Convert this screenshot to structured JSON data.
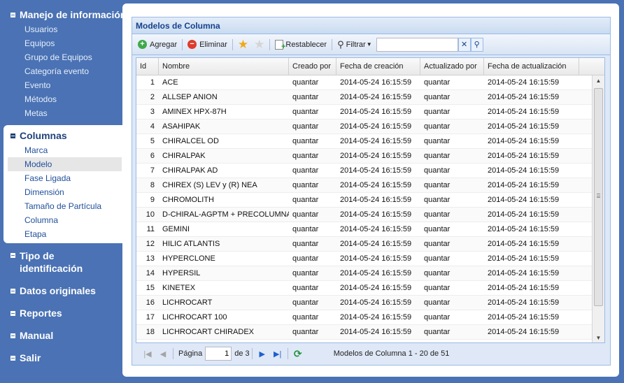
{
  "sidebar": {
    "groups": [
      {
        "label": "Manejo de información",
        "items": [
          "Usuarios",
          "Equipos",
          "Grupo de Equipos",
          "Categoría evento",
          "Evento",
          "Métodos",
          "Metas"
        ]
      },
      {
        "label": "Columnas",
        "items": [
          "Marca",
          "Modelo",
          "Fase Ligada",
          "Dimensión",
          "Tamaño de Partícula",
          "Columna",
          "Etapa"
        ]
      },
      {
        "label": "Tipo de identificación"
      },
      {
        "label": "Datos originales"
      },
      {
        "label": "Reportes"
      },
      {
        "label": "Manual"
      },
      {
        "label": "Salir"
      }
    ]
  },
  "panel": {
    "title": "Modelos de Columna",
    "toolbar": {
      "add": "Agregar",
      "delete": "Eliminar",
      "reset": "Restablecer",
      "filter": "Filtrar",
      "search_value": ""
    }
  },
  "grid": {
    "columns": [
      "Id",
      "Nombre",
      "Creado por",
      "Fecha de creación",
      "Actualizado por",
      "Fecha de actualización"
    ],
    "rows": [
      [
        "1",
        "ACE",
        "quantar",
        "2014-05-24 16:15:59",
        "quantar",
        "2014-05-24 16:15:59"
      ],
      [
        "2",
        "ALLSEP ANION",
        "quantar",
        "2014-05-24 16:15:59",
        "quantar",
        "2014-05-24 16:15:59"
      ],
      [
        "3",
        "AMINEX HPX-87H",
        "quantar",
        "2014-05-24 16:15:59",
        "quantar",
        "2014-05-24 16:15:59"
      ],
      [
        "4",
        "ASAHIPAK",
        "quantar",
        "2014-05-24 16:15:59",
        "quantar",
        "2014-05-24 16:15:59"
      ],
      [
        "5",
        "CHIRALCEL OD",
        "quantar",
        "2014-05-24 16:15:59",
        "quantar",
        "2014-05-24 16:15:59"
      ],
      [
        "6",
        "CHIRALPAK",
        "quantar",
        "2014-05-24 16:15:59",
        "quantar",
        "2014-05-24 16:15:59"
      ],
      [
        "7",
        "CHIRALPAK AD",
        "quantar",
        "2014-05-24 16:15:59",
        "quantar",
        "2014-05-24 16:15:59"
      ],
      [
        "8",
        "CHIREX (S) LEV y (R) NEA",
        "quantar",
        "2014-05-24 16:15:59",
        "quantar",
        "2014-05-24 16:15:59"
      ],
      [
        "9",
        "CHROMOLITH",
        "quantar",
        "2014-05-24 16:15:59",
        "quantar",
        "2014-05-24 16:15:59"
      ],
      [
        "10",
        "D-CHIRAL-AGPTM + PRECOLUMNA",
        "quantar",
        "2014-05-24 16:15:59",
        "quantar",
        "2014-05-24 16:15:59"
      ],
      [
        "11",
        "GEMINI",
        "quantar",
        "2014-05-24 16:15:59",
        "quantar",
        "2014-05-24 16:15:59"
      ],
      [
        "12",
        "HILIC ATLANTIS",
        "quantar",
        "2014-05-24 16:15:59",
        "quantar",
        "2014-05-24 16:15:59"
      ],
      [
        "13",
        "HYPERCLONE",
        "quantar",
        "2014-05-24 16:15:59",
        "quantar",
        "2014-05-24 16:15:59"
      ],
      [
        "14",
        "HYPERSIL",
        "quantar",
        "2014-05-24 16:15:59",
        "quantar",
        "2014-05-24 16:15:59"
      ],
      [
        "15",
        "KINETEX",
        "quantar",
        "2014-05-24 16:15:59",
        "quantar",
        "2014-05-24 16:15:59"
      ],
      [
        "16",
        "LICHROCART",
        "quantar",
        "2014-05-24 16:15:59",
        "quantar",
        "2014-05-24 16:15:59"
      ],
      [
        "17",
        "LICHROCART 100",
        "quantar",
        "2014-05-24 16:15:59",
        "quantar",
        "2014-05-24 16:15:59"
      ],
      [
        "18",
        "LICHROCART CHIRADEX",
        "quantar",
        "2014-05-24 16:15:59",
        "quantar",
        "2014-05-24 16:15:59"
      ]
    ]
  },
  "pager": {
    "page_label": "Página",
    "page_value": "1",
    "of_label": "de 3",
    "summary": "Modelos de Columna 1 - 20 de 51"
  }
}
